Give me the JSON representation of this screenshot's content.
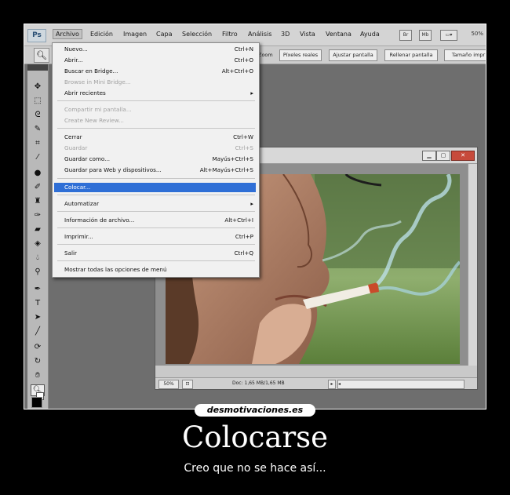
{
  "app": {
    "logo": "Ps"
  },
  "menubar": {
    "items": [
      "Archivo",
      "Edición",
      "Imagen",
      "Capa",
      "Selección",
      "Filtro",
      "Análisis",
      "3D",
      "Vista",
      "Ventana",
      "Ayuda"
    ],
    "bridge_icon": "Br",
    "minibridge_icon": "Mb",
    "zoom_level": "50%"
  },
  "options_bar": {
    "tool_icon": "zoom-icon",
    "zoom_label": "Zoom",
    "buttons": [
      "Píxeles reales",
      "Ajustar pantalla",
      "Rellenar pantalla",
      "Tamaño impr"
    ]
  },
  "file_menu": {
    "items": [
      {
        "label": "Nuevo...",
        "shortcut": "Ctrl+N"
      },
      {
        "label": "Abrir...",
        "shortcut": "Ctrl+O"
      },
      {
        "label": "Buscar en Bridge...",
        "shortcut": "Alt+Ctrl+O"
      },
      {
        "label": "Browse in Mini Bridge...",
        "shortcut": ""
      },
      {
        "label": "Abrir recientes",
        "shortcut": ""
      },
      {
        "label": "Compartir mi pantalla...",
        "shortcut": ""
      },
      {
        "label": "Create New Review...",
        "shortcut": ""
      },
      {
        "label": "Cerrar",
        "shortcut": "Ctrl+W"
      },
      {
        "label": "Guardar",
        "shortcut": "Ctrl+S"
      },
      {
        "label": "Guardar como...",
        "shortcut": "Mayús+Ctrl+S"
      },
      {
        "label": "Guardar para Web y dispositivos...",
        "shortcut": "Alt+Mayús+Ctrl+S"
      },
      {
        "label": "Colocar...",
        "shortcut": ""
      },
      {
        "label": "Automatizar",
        "shortcut": ""
      },
      {
        "label": "Información de archivo...",
        "shortcut": "Alt+Ctrl+I"
      },
      {
        "label": "Imprimir...",
        "shortcut": "Ctrl+P"
      },
      {
        "label": "Salir",
        "shortcut": "Ctrl+Q"
      },
      {
        "label": "Mostrar todas las opciones de menú",
        "shortcut": ""
      }
    ],
    "submenu_arrow": "▸"
  },
  "document": {
    "status_zoom": "50%",
    "status_doc": "Doc: 1,65 MB/1,65 MB"
  },
  "footer": {
    "site": "desmotivaciones.es",
    "title": "Colocarse",
    "subtitle": "Creo que no se hace así..."
  },
  "colors": {
    "highlight": "#2f6fd6",
    "background": "#000000",
    "workspace": "#6e6e6e"
  }
}
